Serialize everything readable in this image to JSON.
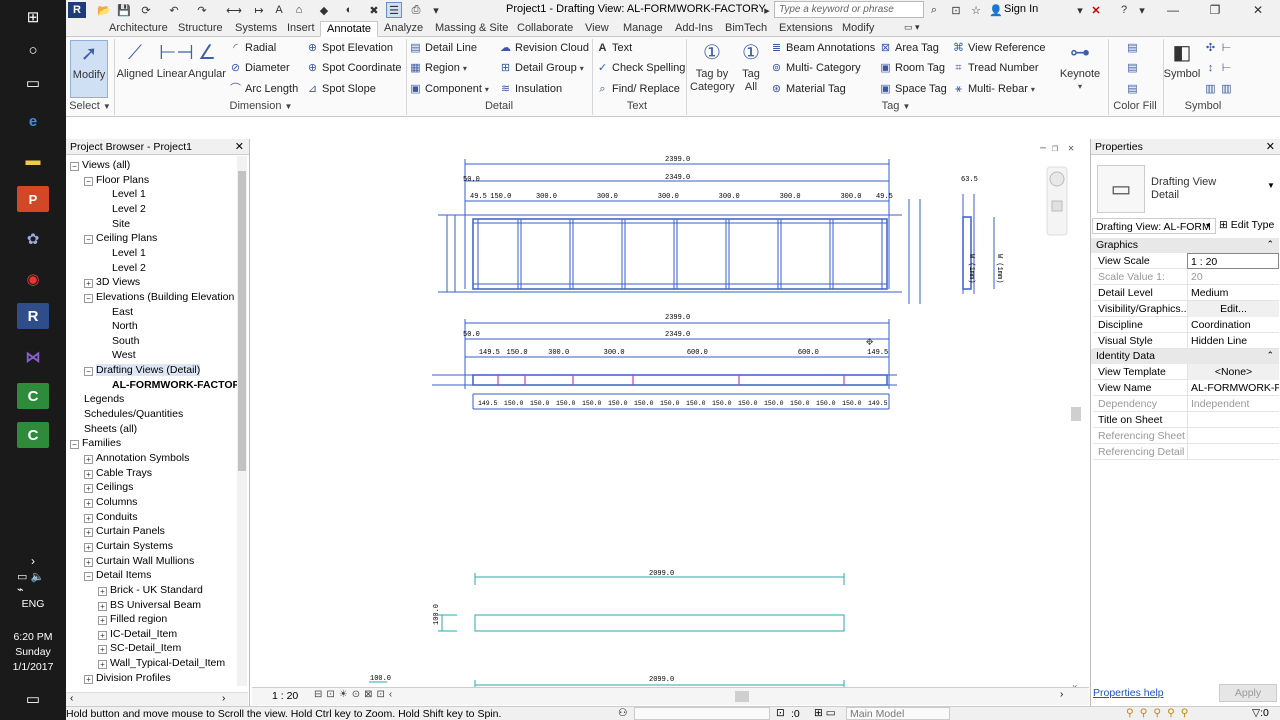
{
  "titlebar": {
    "title": "Project1 - Drafting View: AL-FORMWORK-FACTORY",
    "search_placeholder": "Type a keyword or phrase",
    "sign_in": "Sign In"
  },
  "ribbon_tabs": [
    "Architecture",
    "Structure",
    "Systems",
    "Insert",
    "Annotate",
    "Analyze",
    "Massing & Site",
    "Collaborate",
    "View",
    "Manage",
    "Add-Ins",
    "BimTech",
    "Extensions",
    "Modify"
  ],
  "active_tab": "Annotate",
  "ribbon": {
    "modify": "Modify",
    "select_label": "Select",
    "dimension": {
      "label": "Dimension",
      "aligned": "Aligned",
      "linear": "Linear",
      "angular": "Angular",
      "radial": "Radial",
      "diameter": "Diameter",
      "arc_length": "Arc Length",
      "spot_elevation": "Spot Elevation",
      "spot_coordinate": "Spot Coordinate",
      "spot_slope": "Spot Slope"
    },
    "detail": {
      "label": "Detail",
      "detail_line": "Detail Line",
      "region": "Region",
      "component": "Component",
      "revision_cloud": "Revision Cloud",
      "detail_group": "Detail Group",
      "insulation": "Insulation"
    },
    "text": {
      "label": "Text",
      "text": "Text",
      "check_spelling": "Check Spelling",
      "find_replace": "Find/ Replace"
    },
    "tag": {
      "label": "Tag",
      "tag_by_category": "Tag by Category",
      "tag_all": "Tag All",
      "beam_annotations": "Beam Annotations",
      "multi_category": "Multi- Category",
      "material_tag": "Material Tag",
      "area_tag": "Area Tag",
      "room_tag": "Room Tag",
      "space_tag": "Space Tag",
      "view_reference": "View Reference",
      "tread_number": "Tread Number",
      "multi_rebar": "Multi- Rebar",
      "keynote": "Keynote"
    },
    "color_fill_label": "Color Fill",
    "symbol": {
      "label": "Symbol",
      "symbol": "Symbol"
    }
  },
  "project_browser": {
    "title": "Project Browser - Project1",
    "items": [
      {
        "label": "Views (all)",
        "level": 0,
        "exp": "-"
      },
      {
        "label": "Floor Plans",
        "level": 1,
        "exp": "-"
      },
      {
        "label": "Level 1",
        "level": 2,
        "exp": ""
      },
      {
        "label": "Level 2",
        "level": 2,
        "exp": ""
      },
      {
        "label": "Site",
        "level": 2,
        "exp": ""
      },
      {
        "label": "Ceiling Plans",
        "level": 1,
        "exp": "-"
      },
      {
        "label": "Level 1",
        "level": 2,
        "exp": ""
      },
      {
        "label": "Level 2",
        "level": 2,
        "exp": ""
      },
      {
        "label": "3D Views",
        "level": 1,
        "exp": "+"
      },
      {
        "label": "Elevations (Building Elevation",
        "level": 1,
        "exp": "-"
      },
      {
        "label": "East",
        "level": 2,
        "exp": ""
      },
      {
        "label": "North",
        "level": 2,
        "exp": ""
      },
      {
        "label": "South",
        "level": 2,
        "exp": ""
      },
      {
        "label": "West",
        "level": 2,
        "exp": ""
      },
      {
        "label": "Drafting Views (Detail)",
        "level": 1,
        "exp": "-"
      },
      {
        "label": "AL-FORMWORK-FACTORY",
        "level": 2,
        "exp": "",
        "bold": true
      },
      {
        "label": "Legends",
        "level": 0,
        "exp": ""
      },
      {
        "label": "Schedules/Quantities",
        "level": 0,
        "exp": ""
      },
      {
        "label": "Sheets (all)",
        "level": 0,
        "exp": ""
      },
      {
        "label": "Families",
        "level": 0,
        "exp": "-"
      },
      {
        "label": "Annotation Symbols",
        "level": 1,
        "exp": "+"
      },
      {
        "label": "Cable Trays",
        "level": 1,
        "exp": "+"
      },
      {
        "label": "Ceilings",
        "level": 1,
        "exp": "+"
      },
      {
        "label": "Columns",
        "level": 1,
        "exp": "+"
      },
      {
        "label": "Conduits",
        "level": 1,
        "exp": "+"
      },
      {
        "label": "Curtain Panels",
        "level": 1,
        "exp": "+"
      },
      {
        "label": "Curtain Systems",
        "level": 1,
        "exp": "+"
      },
      {
        "label": "Curtain Wall Mullions",
        "level": 1,
        "exp": "+"
      },
      {
        "label": "Detail Items",
        "level": 1,
        "exp": "-"
      },
      {
        "label": "Brick - UK Standard",
        "level": 2,
        "exp": "+"
      },
      {
        "label": "BS Universal Beam",
        "level": 2,
        "exp": "+"
      },
      {
        "label": "Filled region",
        "level": 2,
        "exp": "+"
      },
      {
        "label": "IC-Detail_Item",
        "level": 2,
        "exp": "+"
      },
      {
        "label": "SC-Detail_Item",
        "level": 2,
        "exp": "+"
      },
      {
        "label": "Wall_Typical-Detail_Item",
        "level": 2,
        "exp": "+"
      },
      {
        "label": "Division Profiles",
        "level": 1,
        "exp": "+"
      }
    ]
  },
  "drawing": {
    "top_overall": "2399.0",
    "top_inner": "2349.0",
    "top_left_small": "50.0",
    "top_segments": [
      "49.5",
      "150.0",
      "300.0",
      "300.0",
      "300.0",
      "300.0",
      "300.0",
      "300.0",
      "49.5"
    ],
    "mid_overall": "2399.0",
    "mid_inner": "2349.0",
    "mid_left_small": "50.0",
    "mid_segments": [
      "149.5",
      "150.0",
      "300.0",
      "300.0",
      "600.0",
      "600.0",
      "149.5"
    ],
    "bottom_segments": [
      "149.5",
      "150.0",
      "150.0",
      "150.0",
      "150.0",
      "150.0",
      "150.0",
      "150.0",
      "150.0",
      "150.0",
      "150.0",
      "150.0",
      "150.0",
      "150.0",
      "150.0",
      "149.5"
    ],
    "right_small": "63.5",
    "vert_labels": [
      "W (1mm)",
      "W (1mm)"
    ],
    "lower_overall_1": "2099.0",
    "lower_overall_2": "2099.0",
    "lower_side": "100.0",
    "lower_corner": "100.0"
  },
  "view_control": {
    "scale": "1 : 20"
  },
  "properties": {
    "title": "Properties",
    "type_name_1": "Drafting View",
    "type_name_2": "Detail",
    "selector": "Drafting View: AL-FORM",
    "edit_type": "Edit Type",
    "groups": [
      {
        "group": "Graphics",
        "rows": [
          {
            "name": "View Scale",
            "value": "1 : 20",
            "grey": false
          },
          {
            "name": "Scale Value    1:",
            "value": "20",
            "grey": true
          },
          {
            "name": "Detail Level",
            "value": "Medium",
            "grey": false
          },
          {
            "name": "Visibility/Graphics...",
            "value": "Edit...",
            "grey": false
          },
          {
            "name": "Discipline",
            "value": "Coordination",
            "grey": false
          },
          {
            "name": "Visual Style",
            "value": "Hidden Line",
            "grey": false
          }
        ]
      },
      {
        "group": "Identity Data",
        "rows": [
          {
            "name": "View Template",
            "value": "<None>",
            "grey": false
          },
          {
            "name": "View Name",
            "value": "AL-FORMWORK-F...",
            "grey": false
          },
          {
            "name": "Dependency",
            "value": "Independent",
            "grey": true
          },
          {
            "name": "Title on Sheet",
            "value": "",
            "grey": false
          },
          {
            "name": "Referencing Sheet",
            "value": "",
            "grey": true
          },
          {
            "name": "Referencing Detail",
            "value": "",
            "grey": true
          }
        ]
      }
    ],
    "help_link": "Properties help",
    "apply": "Apply"
  },
  "statusbar": {
    "message": "Hold button and move mouse to Scroll the view. Hold Ctrl key to Zoom. Hold Shift key to Spin.",
    "filter_count": ":0",
    "model": "Main Model"
  },
  "taskbar": {
    "time": "6:20 PM",
    "day": "Sunday",
    "date": "1/1/2017",
    "lang": "ENG"
  },
  "colors": {
    "drawing_blue": "#3a5fc8",
    "drawing_magenta": "#c03cc0",
    "drawing_teal": "#2aa8a8",
    "taskbar_bg": "#1a1a1a"
  }
}
